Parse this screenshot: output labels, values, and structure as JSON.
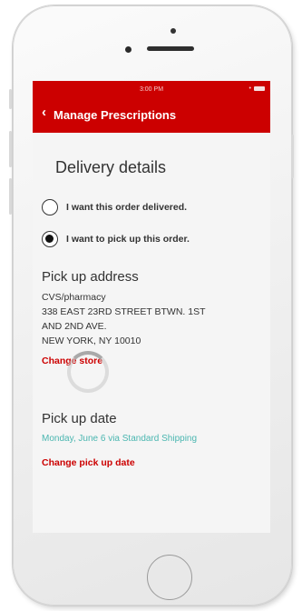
{
  "status_bar": {
    "time": "3:00 PM",
    "signal": "•"
  },
  "nav": {
    "back_icon": "chevron-left-icon",
    "title": "Manage Prescriptions"
  },
  "page": {
    "heading": "Delivery details"
  },
  "options": [
    {
      "label": "I want this order delivered.",
      "selected": false
    },
    {
      "label": "I want to pick up this order.",
      "selected": true
    }
  ],
  "pickup_address": {
    "title": "Pick up address",
    "lines": [
      "CVS/pharmacy",
      "338 EAST 23RD STREET BTWN. 1ST",
      "AND 2ND AVE.",
      "NEW YORK, NY 10010"
    ],
    "change_label": "Change store"
  },
  "pickup_date": {
    "title": "Pick up date",
    "date_text": "Monday, June 6 via Standard Shipping",
    "change_label": "Change pick up date"
  },
  "colors": {
    "brand_red": "#cc0000",
    "teal": "#4ab6b0"
  }
}
